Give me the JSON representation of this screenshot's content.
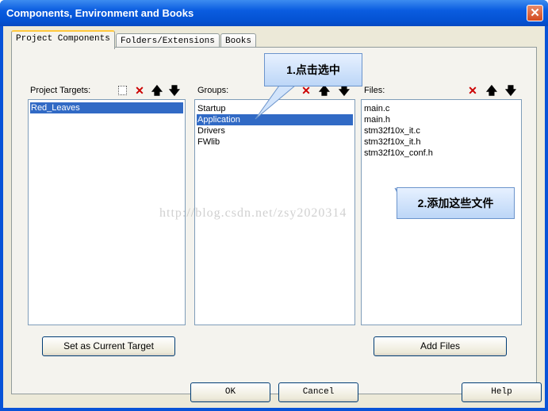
{
  "window": {
    "title": "Components, Environment and Books",
    "close_glyph": "✕"
  },
  "tabs": [
    {
      "label": "Project Components"
    },
    {
      "label": "Folders/Extensions"
    },
    {
      "label": "Books"
    }
  ],
  "targets": {
    "label": "Project Targets:",
    "items": [
      "Red_Leaves"
    ],
    "selected": 0,
    "set_current_label": "Set as Current Target"
  },
  "groups": {
    "label": "Groups:",
    "items": [
      "Startup",
      "Application",
      "Drivers",
      "FWlib"
    ],
    "selected": 1
  },
  "files": {
    "label": "Files:",
    "items": [
      "main.c",
      "main.h",
      "stm32f10x_it.c",
      "stm32f10x_it.h",
      "stm32f10x_conf.h"
    ],
    "add_label": "Add Files"
  },
  "toolbar": {
    "new_icon": "new-item-icon",
    "delete_icon": "delete-icon",
    "up_icon": "move-up-icon",
    "down_icon": "move-down-icon",
    "delete_glyph": "✕",
    "up_glyph": "🡅",
    "down_glyph": "🡇"
  },
  "annotations": {
    "callout1": "1.点击选中",
    "callout2": "2.添加这些文件",
    "watermark": "http://blog.csdn.net/zsy2020314"
  },
  "footer": {
    "ok": "OK",
    "cancel": "Cancel",
    "help": "Help"
  },
  "colors": {
    "title_bar": "#0a5ce0",
    "selection": "#316ac5",
    "delete": "#cc0000",
    "dialog": "#ece9d8"
  }
}
